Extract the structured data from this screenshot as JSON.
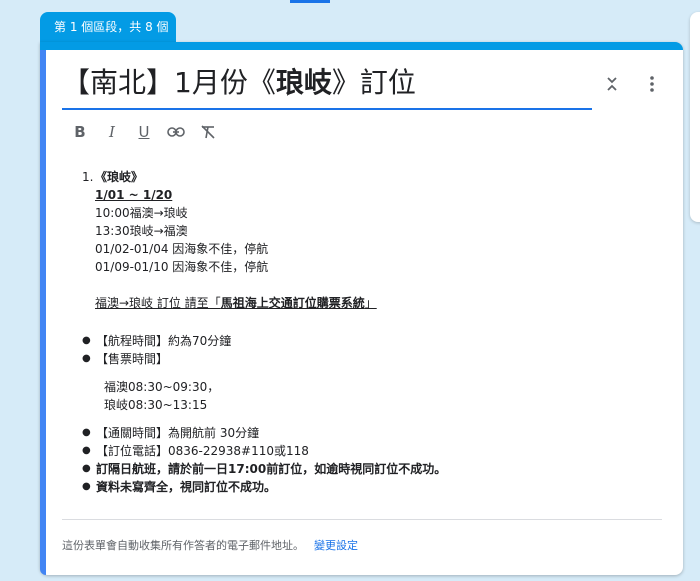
{
  "section_tab": "第 1 個區段，共 8 個",
  "title": {
    "prefix": "【南北】1月份《",
    "bold": "琅岐",
    "suffix": "》訂位"
  },
  "toolbar": {
    "bold": "B",
    "italic": "I",
    "underline": "U",
    "link": "link-icon",
    "clear": "clear-format-icon"
  },
  "description": {
    "ordered": {
      "number": "1.",
      "heading": "《琅岐》",
      "date_range": "1/01 ~ 1/20",
      "lines": [
        "10:00福澳→琅岐",
        "13:30琅岐→福澳",
        "01/02-01/04 因海象不佳，停航",
        "01/09-01/10 因海象不佳，停航"
      ],
      "booking_prefix": "福澳→琅岐 訂位 請至「",
      "booking_bold": "馬祖海上交通訂位購票系統",
      "booking_suffix": "」"
    },
    "bullets": [
      {
        "text": "【航程時間】約為70分鐘",
        "bold": false
      },
      {
        "text": "【售票時間】",
        "bold": false
      }
    ],
    "sale_times": [
      "福澳08:30~09:30，",
      "琅岐08:30~13:15"
    ],
    "bullets2": [
      {
        "text": "【通關時間】為開航前 30分鐘",
        "bold": false
      },
      {
        "text": "【訂位電話】0836-22938#110或118",
        "bold": false
      },
      {
        "text": "訂隔日航班，請於前一日17:00前訂位，如逾時視同訂位不成功。",
        "bold": true
      },
      {
        "text": "資料未寫齊全，視同訂位不成功。",
        "bold": true
      }
    ]
  },
  "footer": {
    "text": "這份表單會自動收集所有作答者的電子郵件地址。",
    "link": "變更設定"
  }
}
